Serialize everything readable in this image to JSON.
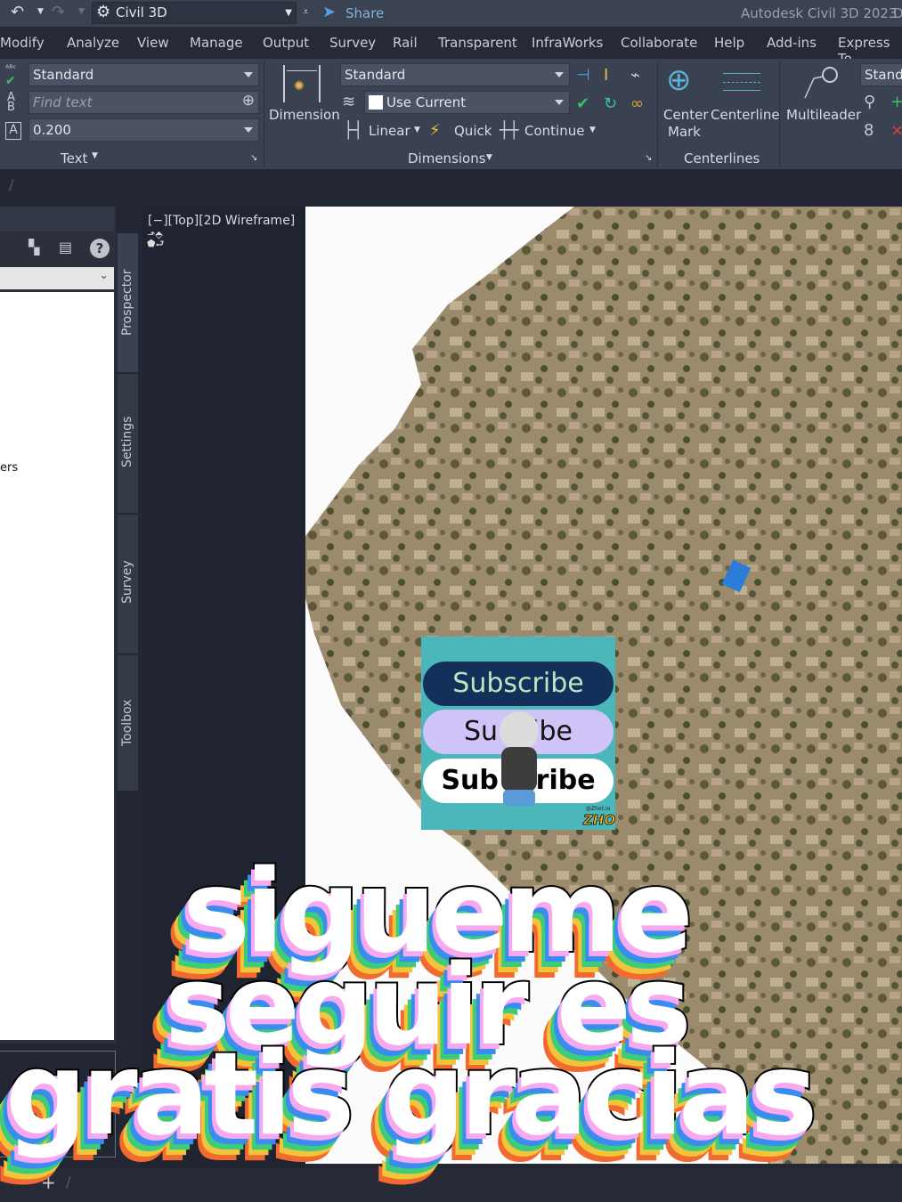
{
  "titlebar": {
    "workspace": "Civil 3D",
    "share": "Share",
    "app_title": "Autodesk Civil 3D 2023",
    "cut": "D"
  },
  "menu": [
    "Modify",
    "Analyze",
    "View",
    "Manage",
    "Output",
    "Survey",
    "Rail",
    "Transparent",
    "InfraWorks",
    "Collaborate",
    "Help",
    "Add-ins",
    "Express To"
  ],
  "ribbon": {
    "text": {
      "style": "Standard",
      "find_placeholder": "Find text",
      "height": "0.200",
      "panel": "Text"
    },
    "dimensions": {
      "big": "Dimension",
      "style": "Standard",
      "layer": "Use Current",
      "linear": "Linear",
      "quick": "Quick",
      "continue": "Continue",
      "panel": "Dimensions"
    },
    "centerlines": {
      "center_mark_1": "Center",
      "center_mark_2": "Mark",
      "centerline": "Centerline",
      "panel": "Centerlines"
    },
    "leaders": {
      "multileader": "Multileader",
      "style": "Standa"
    }
  },
  "panel": {
    "tree_text": "ers",
    "tabs": [
      "Prospector",
      "Settings",
      "Survey",
      "Toolbox"
    ]
  },
  "viewport": {
    "label": "[−][Top][2D Wireframe]"
  },
  "overlay": {
    "subscribe": [
      "Subscribe",
      "Su    ibe",
      "Sub    ribe"
    ],
    "brand_handle": "@Zhot.io",
    "brand": "ZHOT"
  },
  "caption": [
    "sigueme",
    "seguir es",
    "gratis gracias"
  ],
  "colors": {
    "accent": "#4fa3e0",
    "sub_dark": "#12305a",
    "sub_lilac": "#cfc3f8",
    "teal": "#4bb7ba"
  }
}
